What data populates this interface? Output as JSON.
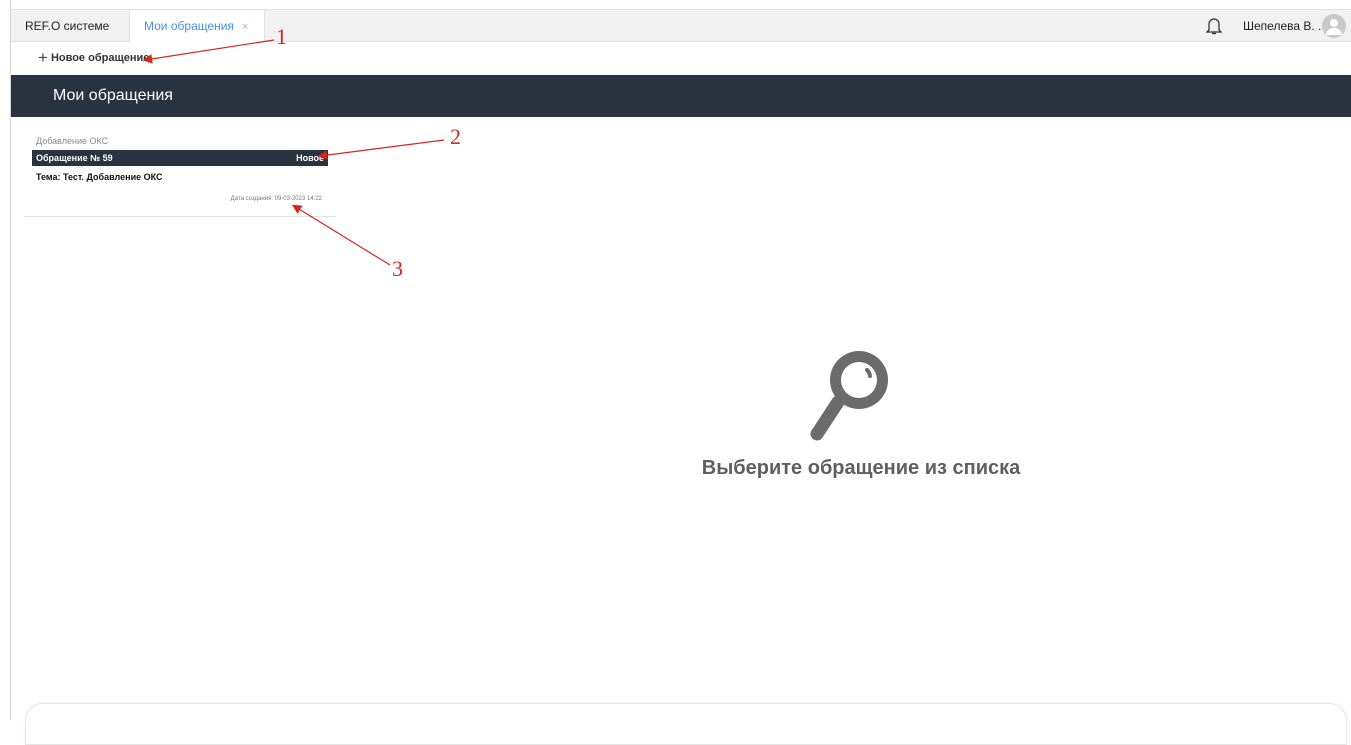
{
  "tabs": [
    {
      "label": "REF.O системе"
    },
    {
      "label": "Мои обращения",
      "close_glyph": "×"
    }
  ],
  "user": {
    "name": "Шепелева В. ..."
  },
  "toolbar": {
    "new_label": "Новое обращение"
  },
  "header": {
    "title": "Мои обращения"
  },
  "request": {
    "category": "Добавление ОКС",
    "number": "Обращение № 59",
    "status": "Новое",
    "topic": "Тема: Тест. Добавление ОКС",
    "created": "Дата создания: 09-03-2023 14:22"
  },
  "empty_state": {
    "text": "Выберите обращение из списка",
    "icon": "search-icon"
  },
  "annotations": [
    "1",
    "2",
    "3"
  ],
  "colors": {
    "header_bg": "#2a3440",
    "active_tab": "#4a90e2",
    "annotation": "#d1281b"
  }
}
